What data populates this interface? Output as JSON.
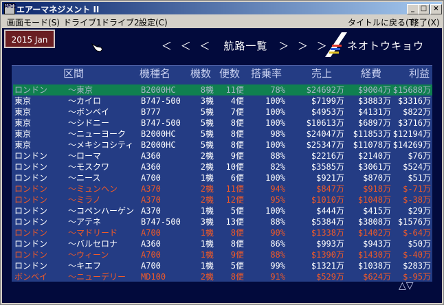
{
  "window": {
    "title": "エアーマネジメント II",
    "icon_text": "AMII",
    "minimize_label": "_",
    "maximize_label": "□",
    "close_label": "×"
  },
  "menu": {
    "items": [
      "画面モード(S)",
      "ドライブ1",
      "ドライブ2",
      "設定(C)",
      "タイトルに戻る(T)",
      "終了(X)"
    ]
  },
  "game": {
    "date": "2015 Jan",
    "heading_left": "＜ ＜ ＜",
    "heading_title": "航路一覧",
    "heading_right": "＞ ＞ ＞",
    "company": "ネオトウキョウ"
  },
  "table": {
    "columns": [
      "区間",
      "機種名",
      "機数",
      "便数",
      "搭乗率",
      "売上",
      "経費",
      "利益"
    ],
    "rows": [
      {
        "from": "ロンドン",
        "to": "～東京",
        "type": "B2000HC",
        "planes": "8機",
        "flights": "11便",
        "load": "78%",
        "sales": "$24692万",
        "cost": "$9004万",
        "profit": "$15688万",
        "color": "g",
        "selected": true
      },
      {
        "from": "東京",
        "to": "～カイロ",
        "type": "B747-500",
        "planes": "3機",
        "flights": "4便",
        "load": "100%",
        "sales": "$7199万",
        "cost": "$3883万",
        "profit": "$3316万",
        "color": "w"
      },
      {
        "from": "東京",
        "to": "～ボンベイ",
        "type": "B777",
        "planes": "5機",
        "flights": "7便",
        "load": "100%",
        "sales": "$4953万",
        "cost": "$4131万",
        "profit": "$822万",
        "color": "w"
      },
      {
        "from": "東京",
        "to": "～シドニー",
        "type": "B747-500",
        "planes": "5機",
        "flights": "8便",
        "load": "100%",
        "sales": "$10613万",
        "cost": "$6897万",
        "profit": "$3716万",
        "color": "w"
      },
      {
        "from": "東京",
        "to": "～ニューヨーク",
        "type": "B2000HC",
        "planes": "5機",
        "flights": "8便",
        "load": "98%",
        "sales": "$24047万",
        "cost": "$11853万",
        "profit": "$12194万",
        "color": "w"
      },
      {
        "from": "東京",
        "to": "～メキシコシティ",
        "type": "B2000HC",
        "planes": "5機",
        "flights": "8便",
        "load": "100%",
        "sales": "$25347万",
        "cost": "$11078万",
        "profit": "$14269万",
        "color": "w"
      },
      {
        "from": "ロンドン",
        "to": "～ローマ",
        "type": "A360",
        "planes": "2機",
        "flights": "9便",
        "load": "88%",
        "sales": "$2216万",
        "cost": "$2140万",
        "profit": "$76万",
        "color": "w"
      },
      {
        "from": "ロンドン",
        "to": "～モスクワ",
        "type": "A360",
        "planes": "2機",
        "flights": "10便",
        "load": "82%",
        "sales": "$3585万",
        "cost": "$3061万",
        "profit": "$524万",
        "color": "w"
      },
      {
        "from": "ロンドン",
        "to": "～ニース",
        "type": "A700",
        "planes": "1機",
        "flights": "6便",
        "load": "100%",
        "sales": "$921万",
        "cost": "$870万",
        "profit": "$51万",
        "color": "w"
      },
      {
        "from": "ロンドン",
        "to": "～ミュンヘン",
        "type": "A370",
        "planes": "2機",
        "flights": "11便",
        "load": "94%",
        "sales": "$847万",
        "cost": "$918万",
        "profit": "$-71万",
        "color": "r"
      },
      {
        "from": "ロンドン",
        "to": "～ミラノ",
        "type": "A370",
        "planes": "2機",
        "flights": "12便",
        "load": "95%",
        "sales": "$1010万",
        "cost": "$1048万",
        "profit": "$-38万",
        "color": "r"
      },
      {
        "from": "ロンドン",
        "to": "～コペンハーゲン",
        "type": "A370",
        "planes": "1機",
        "flights": "5便",
        "load": "100%",
        "sales": "$444万",
        "cost": "$415万",
        "profit": "$29万",
        "color": "w"
      },
      {
        "from": "ロンドン",
        "to": "～アテネ",
        "type": "B747-500",
        "planes": "3機",
        "flights": "13便",
        "load": "88%",
        "sales": "$5384万",
        "cost": "$3808万",
        "profit": "$1576万",
        "color": "w"
      },
      {
        "from": "ロンドン",
        "to": "～マドリード",
        "type": "A700",
        "planes": "1機",
        "flights": "8便",
        "load": "90%",
        "sales": "$1338万",
        "cost": "$1402万",
        "profit": "$-64万",
        "color": "r"
      },
      {
        "from": "ロンドン",
        "to": "～バルセロナ",
        "type": "A360",
        "planes": "1機",
        "flights": "8便",
        "load": "86%",
        "sales": "$993万",
        "cost": "$943万",
        "profit": "$50万",
        "color": "w"
      },
      {
        "from": "ロンドン",
        "to": "～ウィーン",
        "type": "A700",
        "planes": "1機",
        "flights": "9便",
        "load": "88%",
        "sales": "$1390万",
        "cost": "$1430万",
        "profit": "$-40万",
        "color": "r"
      },
      {
        "from": "ロンドン",
        "to": "～キエフ",
        "type": "A700",
        "planes": "1機",
        "flights": "5便",
        "load": "99%",
        "sales": "$1321万",
        "cost": "$1038万",
        "profit": "$283万",
        "color": "w"
      },
      {
        "from": "ボンベイ",
        "to": "～ニューデリー",
        "type": "MD100",
        "planes": "2機",
        "flights": "8便",
        "load": "91%",
        "sales": "$529万",
        "cost": "$624万",
        "profit": "$-95万",
        "color": "r"
      }
    ]
  },
  "scroll": {
    "up": "▲",
    "down": "▽",
    "both": "▲▽"
  },
  "colors": {
    "selected_row": "#108050",
    "loss_text": "#f05a28",
    "panel": "#243c84",
    "background": "#020a3c"
  }
}
